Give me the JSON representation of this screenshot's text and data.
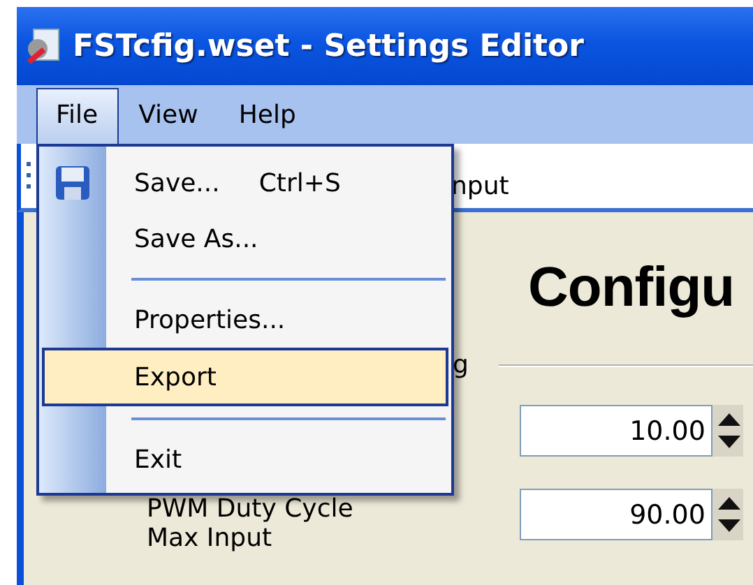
{
  "window": {
    "title": "FSTcfig.wset - Settings Editor"
  },
  "menu_bar": [
    {
      "label": "File",
      "selected": true
    },
    {
      "label": "View",
      "selected": false
    },
    {
      "label": "Help",
      "selected": false
    }
  ],
  "toolbar": {
    "text": "nput"
  },
  "file_menu": [
    {
      "kind": "item",
      "label": "Save...",
      "shortcut": "Ctrl+S",
      "selected": false
    },
    {
      "kind": "item",
      "label": "Save As...",
      "selected": false
    },
    {
      "kind": "separator"
    },
    {
      "kind": "item",
      "label": "Properties...",
      "selected": false
    },
    {
      "kind": "item",
      "label": "Export",
      "selected": true
    },
    {
      "kind": "separator"
    },
    {
      "kind": "item",
      "label": "Exit",
      "selected": false
    }
  ],
  "content": {
    "heading": "Configu",
    "group_label": "g",
    "fields": [
      {
        "value": "10.00"
      },
      {
        "label_lines": [
          "PWM Duty Cycle",
          "Max Input"
        ],
        "value": "90.00"
      }
    ]
  }
}
